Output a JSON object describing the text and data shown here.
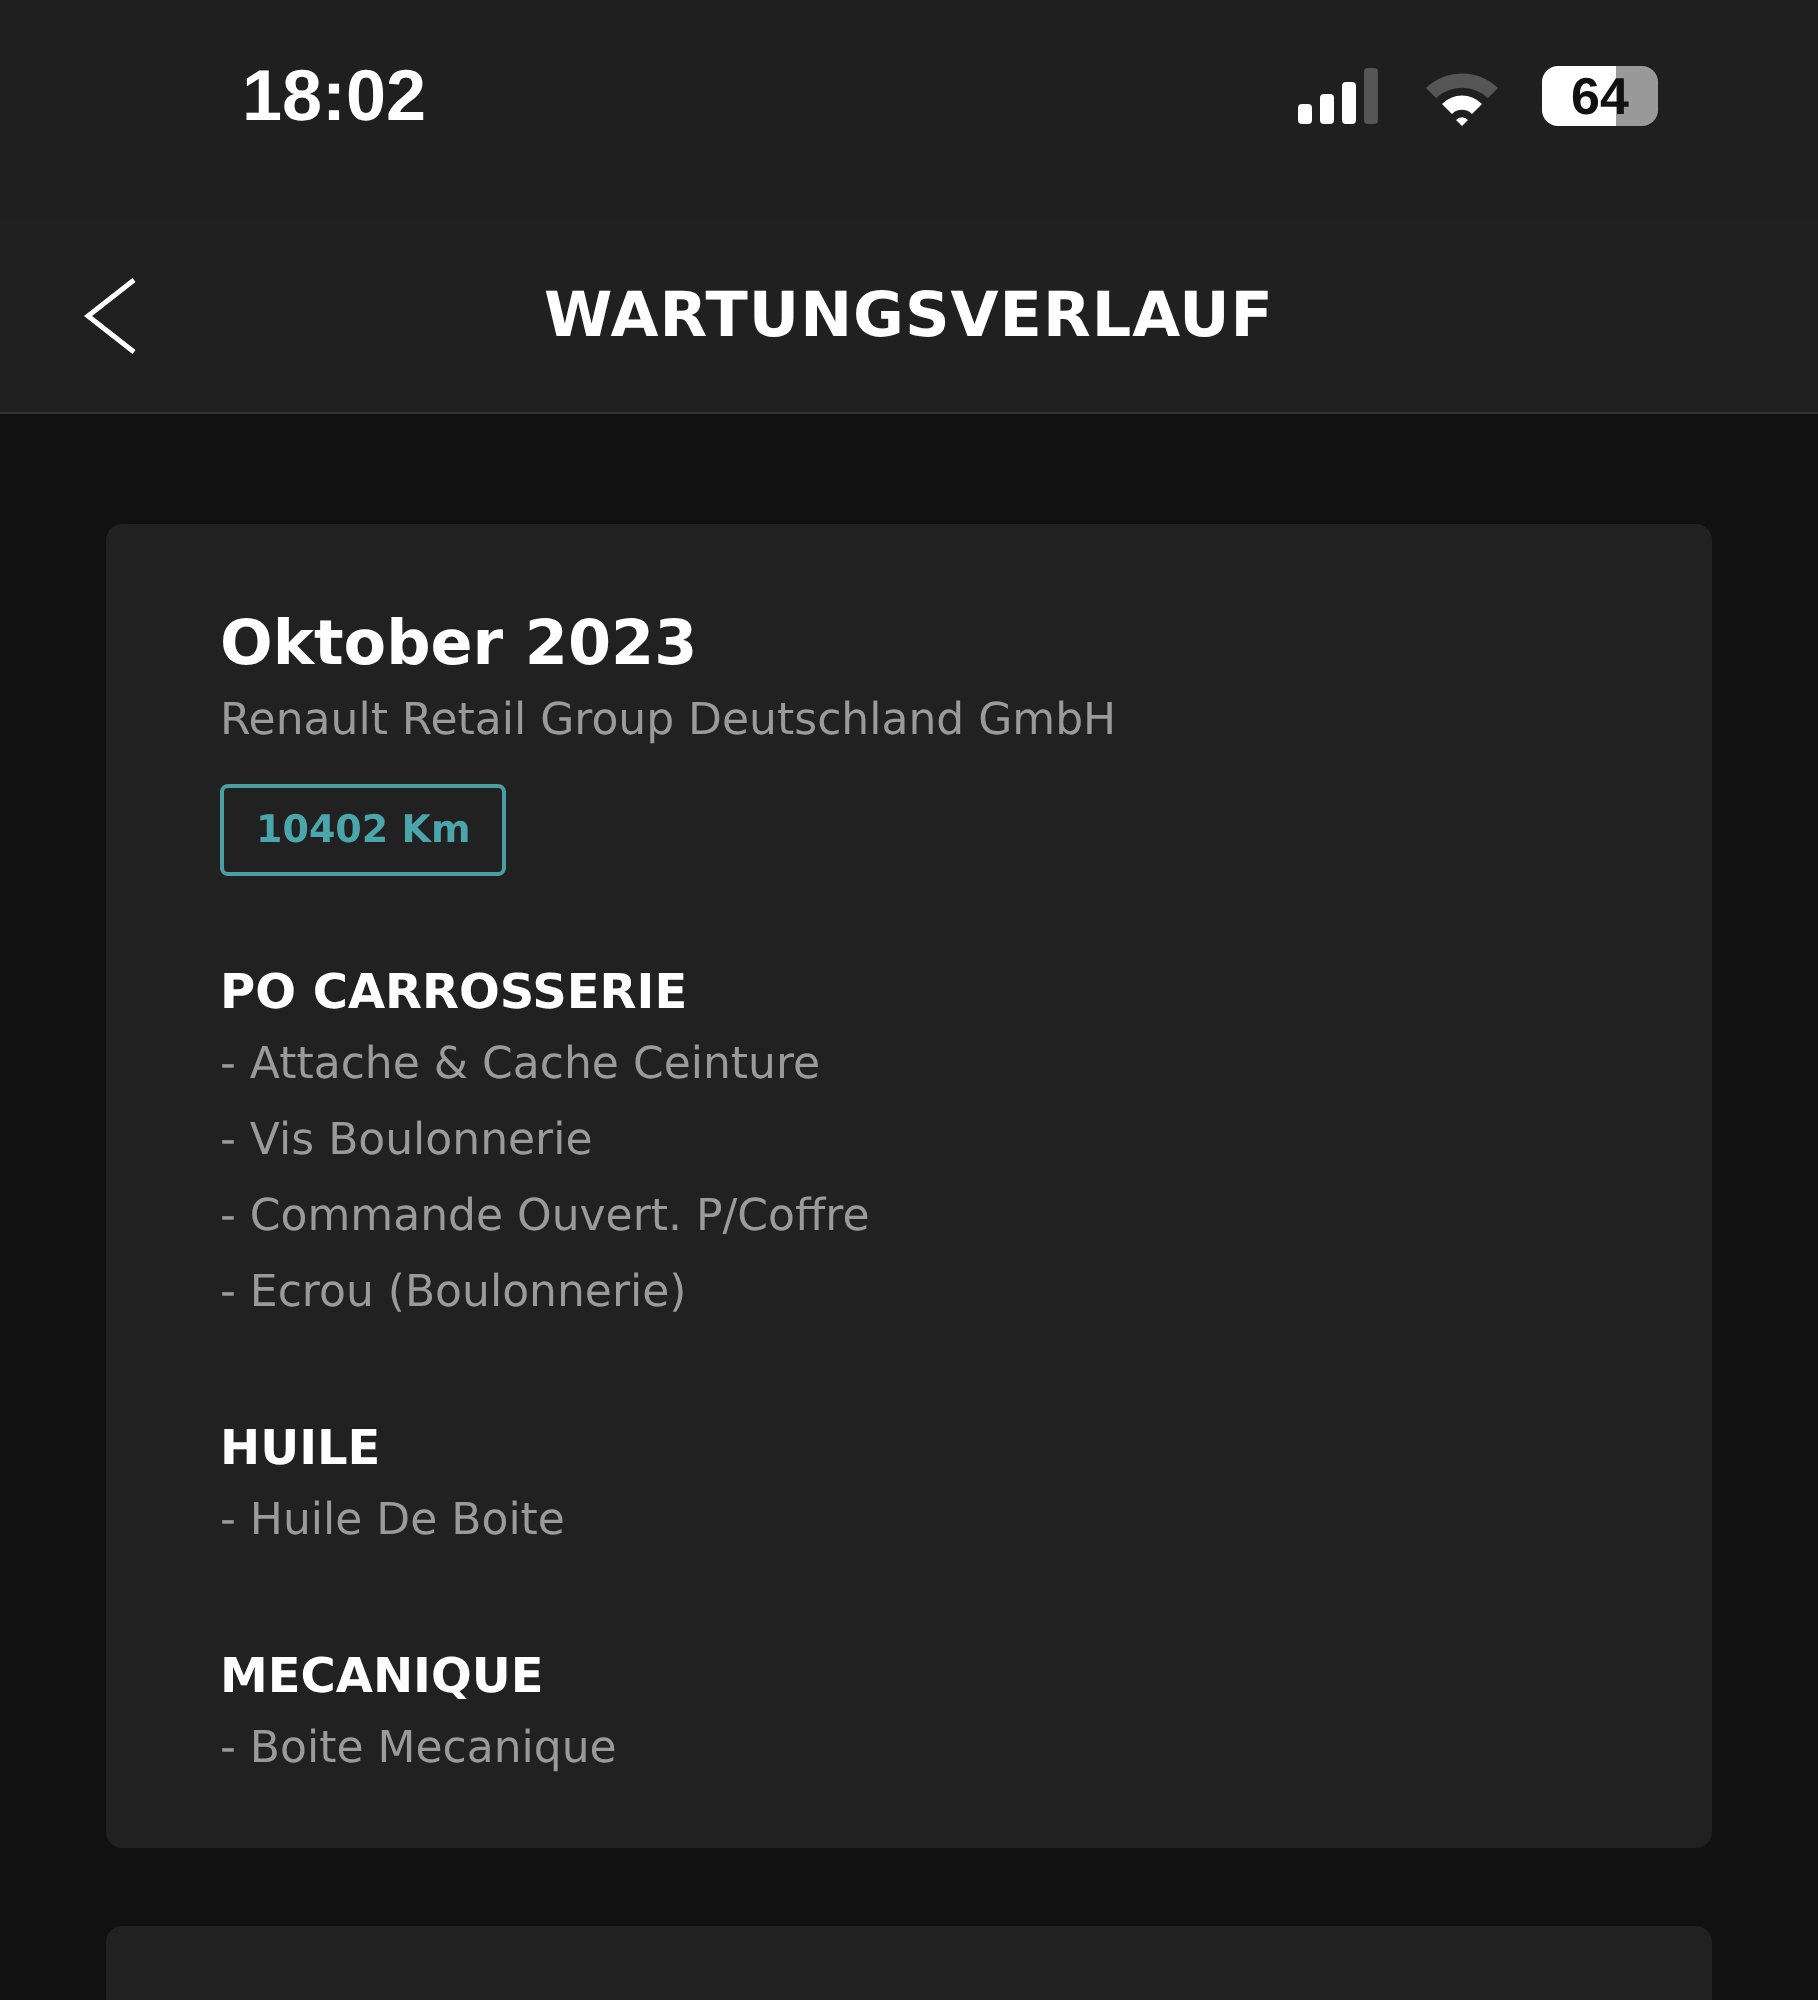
{
  "status_bar": {
    "time": "18:02",
    "battery": "64"
  },
  "header": {
    "title": "WARTUNGSVERLAUF"
  },
  "records": [
    {
      "date": "Oktober 2023",
      "dealer": "Renault Retail Group Deutschland GmbH",
      "mileage": "10402 Km",
      "sections": [
        {
          "title": "PO CARROSSERIE",
          "items": [
            "- Attache & Cache Ceinture",
            "- Vis Boulonnerie",
            "- Commande Ouvert. P/Coffre",
            "- Ecrou (Boulonnerie)"
          ]
        },
        {
          "title": "HUILE",
          "items": [
            "- Huile De Boite"
          ]
        },
        {
          "title": "MECANIQUE",
          "items": [
            "- Boite Mecanique"
          ]
        }
      ]
    }
  ]
}
